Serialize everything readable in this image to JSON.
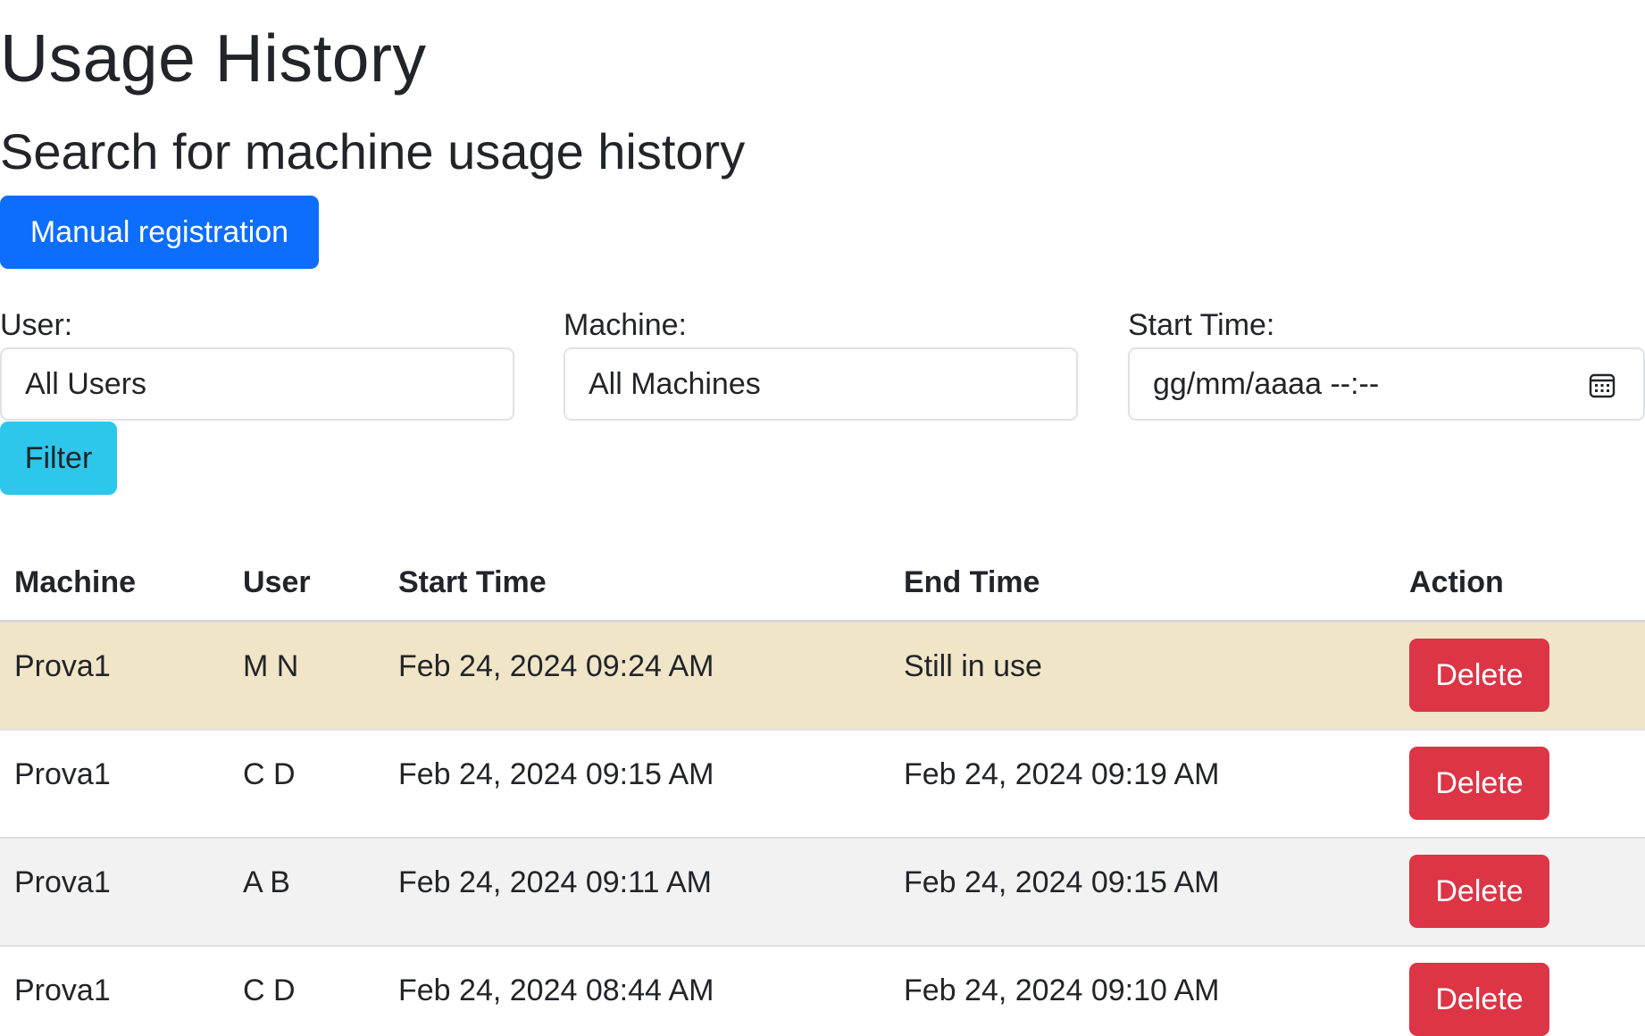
{
  "page": {
    "title": "Usage History",
    "subtitle": "Search for machine usage history"
  },
  "actions": {
    "manual_registration_label": "Manual registration",
    "filter_label": "Filter"
  },
  "filters": {
    "user_label": "User:",
    "user_value": "All Users",
    "machine_label": "Machine:",
    "machine_value": "All Machines",
    "start_time_label": "Start Time:",
    "start_time_placeholder": "gg/mm/aaaa --:--"
  },
  "table": {
    "headers": [
      "Machine",
      "User",
      "Start Time",
      "End Time",
      "Action"
    ],
    "rows": [
      {
        "machine": "Prova1",
        "user": "M N",
        "start": "Feb 24, 2024 09:24 AM",
        "end": "Still in use",
        "action": "Delete"
      },
      {
        "machine": "Prova1",
        "user": "C D",
        "start": "Feb 24, 2024 09:15 AM",
        "end": "Feb 24, 2024 09:19 AM",
        "action": "Delete"
      },
      {
        "machine": "Prova1",
        "user": "A B",
        "start": "Feb 24, 2024 09:11 AM",
        "end": "Feb 24, 2024 09:15 AM",
        "action": "Delete"
      },
      {
        "machine": "Prova1",
        "user": "C D",
        "start": "Feb 24, 2024 08:44 AM",
        "end": "Feb 24, 2024 09:10 AM",
        "action": "Delete"
      }
    ]
  },
  "colors": {
    "primary": "#0d6efd",
    "info": "#2ec7ec",
    "danger": "#dc3545",
    "active_row": "#f1e5c8",
    "striped_row": "#f2f2f2"
  },
  "icons": {
    "calendar": "calendar-icon"
  }
}
